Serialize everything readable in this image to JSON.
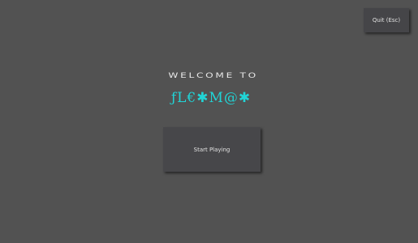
{
  "menu": {
    "quit_label": "Quit (Esc)",
    "welcome_text": "WELCOME TO",
    "game_title": "ƒL€✱M@✱",
    "start_label": "Start Playing"
  },
  "colors": {
    "background": "#525252",
    "button": "#47474a",
    "title_accent": "#21d4d6",
    "text": "#e8e8e8"
  }
}
